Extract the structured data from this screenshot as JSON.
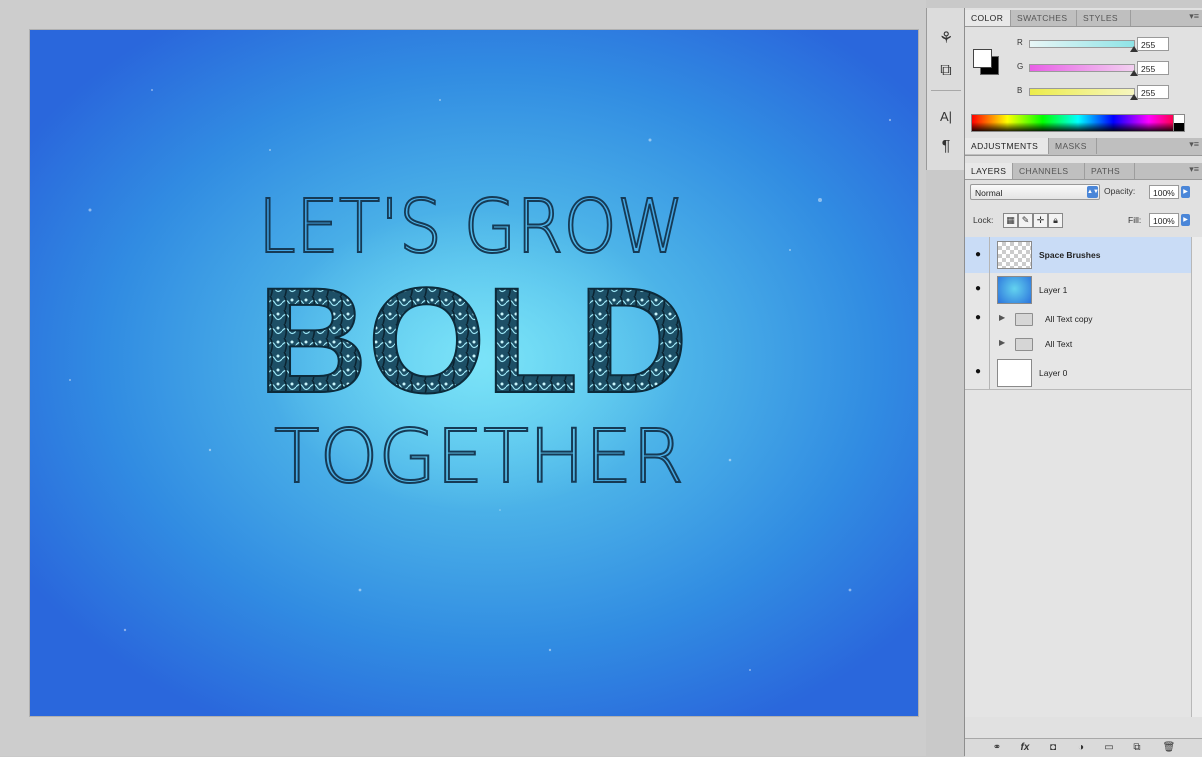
{
  "document": {
    "artwork": {
      "line1": "LET'S GROW",
      "line2": "BOLD",
      "line3": "TOGETHER"
    }
  },
  "tools": [
    {
      "name": "brush-preset-icon",
      "glyph": "⚘"
    },
    {
      "name": "clone-source-icon",
      "glyph": "⧉"
    },
    {
      "name": "character-icon",
      "glyph": "A|"
    },
    {
      "name": "paragraph-icon",
      "glyph": "¶"
    }
  ],
  "color_panel": {
    "tabs": [
      "COLOR",
      "SWATCHES",
      "STYLES"
    ],
    "channels": [
      {
        "label": "R",
        "value": "255",
        "level": 1.0,
        "color_from": "#e8f6f6",
        "color_to": "#8ee3e6"
      },
      {
        "label": "G",
        "value": "255",
        "level": 1.0,
        "color_from": "#e85fe6",
        "color_to": "#f2d0f0"
      },
      {
        "label": "B",
        "value": "255",
        "level": 1.0,
        "color_from": "#ecec4a",
        "color_to": "#f6f6c0"
      }
    ],
    "foreground": "#ffffff",
    "background": "#000000"
  },
  "adjustments_panel": {
    "tabs": [
      "ADJUSTMENTS",
      "MASKS"
    ]
  },
  "layers_panel": {
    "tabs": [
      "LAYERS",
      "CHANNELS",
      "PATHS"
    ],
    "blend_mode": "Normal",
    "opacity_label": "Opacity:",
    "opacity_value": "100%",
    "lock_label": "Lock:",
    "fill_label": "Fill:",
    "fill_value": "100%",
    "layers": [
      {
        "name": "Space Brushes",
        "visible": true,
        "type": "pixel",
        "thumb": "checker",
        "selected": true
      },
      {
        "name": "Layer 1",
        "visible": true,
        "type": "pixel",
        "thumb": "blue",
        "selected": false
      },
      {
        "name": "All Text copy",
        "visible": true,
        "type": "group",
        "thumb": "",
        "selected": false
      },
      {
        "name": "All Text",
        "visible": false,
        "type": "group",
        "thumb": "",
        "selected": false
      },
      {
        "name": "Layer 0",
        "visible": true,
        "type": "pixel",
        "thumb": "white",
        "selected": false
      }
    ],
    "bottom_icons": [
      "link-layers-icon",
      "fx-icon",
      "add-mask-icon",
      "adjustment-layer-icon",
      "new-group-icon",
      "new-layer-icon",
      "trash-icon"
    ]
  }
}
